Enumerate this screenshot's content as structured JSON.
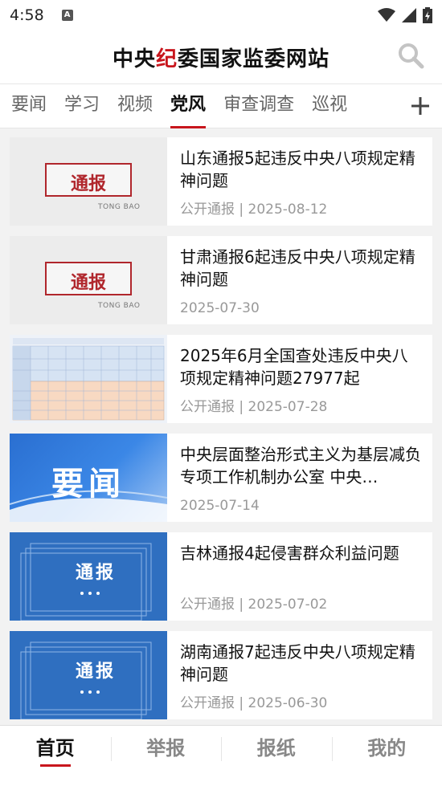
{
  "status_bar": {
    "time": "4:58",
    "notification_icon": "a-icon",
    "icons": [
      "wifi-icon",
      "signal-icon",
      "battery-charging-icon"
    ]
  },
  "header": {
    "title_part1": "中央",
    "title_red": "纪",
    "title_part2": "委国家监委网站",
    "accent_color": "#c8161d",
    "search_icon": "search-icon"
  },
  "tabs": [
    {
      "label": "要闻",
      "active": false
    },
    {
      "label": "学习",
      "active": false
    },
    {
      "label": "视频",
      "active": false
    },
    {
      "label": "党风",
      "active": true
    },
    {
      "label": "审查调查",
      "active": false
    },
    {
      "label": "巡视",
      "active": false
    }
  ],
  "tabs_more_icon": "plus-icon",
  "articles": [
    {
      "title": "山东通报5起违反中央八项规定精神问题",
      "meta": "公开通报 | 2025-08-12",
      "thumb_type": "tongbao-gray",
      "thumb_word": "通报",
      "thumb_sub": "TONG BAO"
    },
    {
      "title": "甘肃通报6起违反中央八项规定精神问题",
      "meta": "2025-07-30",
      "thumb_type": "tongbao-gray",
      "thumb_word": "通报",
      "thumb_sub": "TONG BAO"
    },
    {
      "title": "2025年6月全国查处违反中央八项规定精神问题27977起",
      "meta": "公开通报 | 2025-07-28",
      "thumb_type": "table"
    },
    {
      "title": "中央层面整治形式主义为基层减负专项工作机制办公室 中央…",
      "meta": "2025-07-14",
      "thumb_type": "yaowen",
      "thumb_word": "要闻"
    },
    {
      "title": "吉林通报4起侵害群众利益问题",
      "meta": "公开通报 | 2025-07-02",
      "thumb_type": "blue",
      "thumb_word": "通报"
    },
    {
      "title": "湖南通报7起违反中央八项规定精神问题",
      "meta": "公开通报 | 2025-06-30",
      "thumb_type": "blue",
      "thumb_word": "通报"
    }
  ],
  "bottom_nav": [
    {
      "label": "首页",
      "active": true
    },
    {
      "label": "举报",
      "active": false
    },
    {
      "label": "报纸",
      "active": false
    },
    {
      "label": "我的",
      "active": false
    }
  ]
}
